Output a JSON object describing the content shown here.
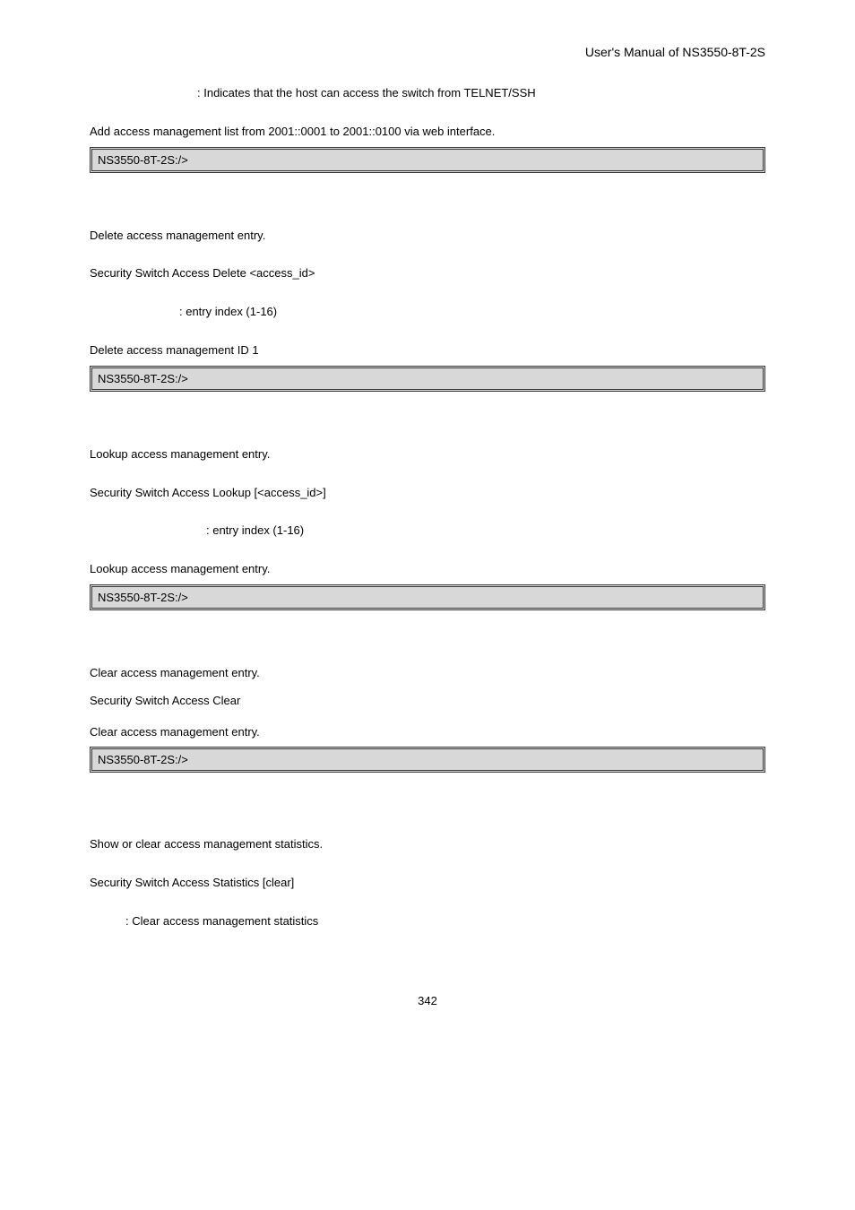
{
  "header": {
    "manual_title": "User's  Manual  of  NS3550-8T-2S"
  },
  "access_add": {
    "telnet_note": ": Indicates that the host can access the switch from TELNET/SSH",
    "example_intro": "Add access management list from 2001::0001 to 2001::0100 via web interface.",
    "prompt": "NS3550-8T-2S:/>"
  },
  "access_delete": {
    "desc": "Delete access management entry.",
    "syntax": "Security Switch Access Delete <access_id>",
    "param": ": entry index (1-16)",
    "example_intro": "Delete access management ID 1",
    "prompt": "NS3550-8T-2S:/>"
  },
  "access_lookup": {
    "desc": "Lookup access management entry.",
    "syntax": "Security Switch Access Lookup [<access_id>]",
    "param": ": entry index (1-16)",
    "example_intro": "Lookup access management entry.",
    "prompt": "NS3550-8T-2S:/>"
  },
  "access_clear": {
    "desc": "Clear access management entry.",
    "syntax": "Security Switch Access Clear",
    "example_intro": "Clear access management entry.",
    "prompt": "NS3550-8T-2S:/>"
  },
  "access_stats": {
    "desc": "Show or clear access management statistics.",
    "syntax": "Security Switch Access Statistics [clear]",
    "param": ": Clear access management statistics"
  },
  "footer": {
    "page_number": "342"
  }
}
